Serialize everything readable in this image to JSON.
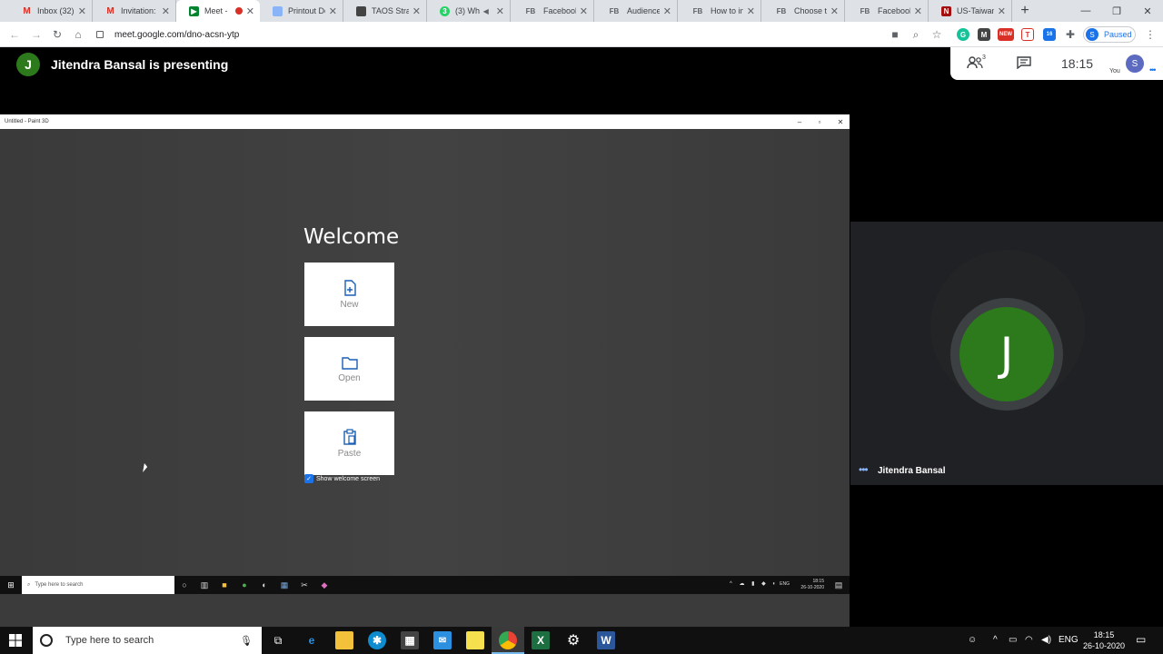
{
  "browser": {
    "tabs": [
      {
        "label": "Inbox (32)",
        "favicon": "gmail-icon"
      },
      {
        "label": "Invitation:",
        "favicon": "gmail-icon"
      },
      {
        "label": "Meet -",
        "favicon": "meet-icon",
        "active": true,
        "recording": true
      },
      {
        "label": "Printout De",
        "favicon": "doc-icon"
      },
      {
        "label": "TAOS Strate",
        "favicon": "slides-icon"
      },
      {
        "label": "(3) Wh",
        "favicon": "whatsapp-icon",
        "muted": true
      },
      {
        "label": "Facebook a",
        "favicon": "fb-icon"
      },
      {
        "label": "Audience I",
        "favicon": "fb-icon"
      },
      {
        "label": "How to inc",
        "favicon": "fb-icon"
      },
      {
        "label": "Choose the",
        "favicon": "fb-icon"
      },
      {
        "label": "Facebook a",
        "favicon": "fb-icon"
      },
      {
        "label": "US-Taiwan",
        "favicon": "news-icon"
      }
    ],
    "fb_favicon_text": "FB",
    "url": "meet.google.com/dno-acsn-ytp",
    "profile_initial": "S",
    "profile_status": "Paused",
    "ext_badge_new": "NEW",
    "ext_badge_16": "16"
  },
  "meet": {
    "presenter_initial": "J",
    "presenter_text": "Jitendra Bansal is presenting",
    "participant_count": "3",
    "time": "18:15",
    "you_initial": "S",
    "you_label": "You",
    "tile_initial": "J",
    "tile_name": "Jitendra Bansal"
  },
  "shared_screen": {
    "window_title": "Untitled - Paint 3D",
    "welcome": "Welcome",
    "cards": [
      {
        "label": "New",
        "icon": "new-file-icon"
      },
      {
        "label": "Open",
        "icon": "folder-icon"
      },
      {
        "label": "Paste",
        "icon": "clipboard-icon"
      }
    ],
    "show_welcome": "Show welcome screen",
    "taskbar_search": "Type here to search",
    "tray_lang": "ENG",
    "tray_time": "18:15",
    "tray_date": "26-10-2020"
  },
  "taskbar": {
    "search_placeholder": "Type here to search",
    "lang": "ENG",
    "time": "18:15",
    "date": "26-10-2020"
  }
}
